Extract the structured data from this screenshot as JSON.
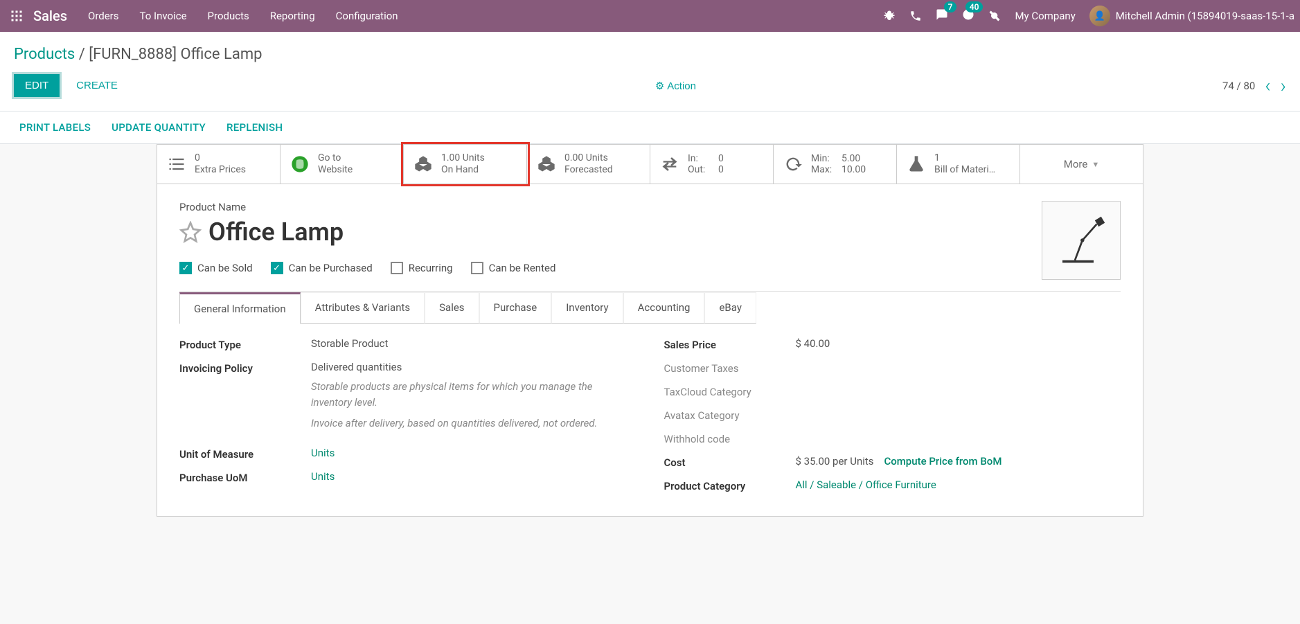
{
  "nav": {
    "brand": "Sales",
    "menu": [
      "Orders",
      "To Invoice",
      "Products",
      "Reporting",
      "Configuration"
    ],
    "messages_badge": "7",
    "activities_badge": "40",
    "company": "My Company",
    "user": "Mitchell Admin (15894019-saas-15-1-a"
  },
  "breadcrumb": {
    "parent": "Products",
    "current": "[FURN_8888] Office Lamp"
  },
  "controls": {
    "edit": "EDIT",
    "create": "CREATE",
    "action": "Action",
    "pager": "74 / 80"
  },
  "status_actions": [
    "PRINT LABELS",
    "UPDATE QUANTITY",
    "REPLENISH"
  ],
  "stats": {
    "extra_prices": {
      "line1": "0",
      "line2": "Extra Prices"
    },
    "website": {
      "line1": "Go to",
      "line2": "Website"
    },
    "on_hand": {
      "line1": "1.00 Units",
      "line2": "On Hand"
    },
    "forecasted": {
      "line1": "0.00 Units",
      "line2": "Forecasted"
    },
    "in_out": {
      "in_label": "In:",
      "in_val": "0",
      "out_label": "Out:",
      "out_val": "0"
    },
    "min_max": {
      "min_label": "Min:",
      "min_val": "5.00",
      "max_label": "Max:",
      "max_val": "10.00"
    },
    "bom": {
      "line1": "1",
      "line2": "Bill of Materi…"
    },
    "more": "More"
  },
  "product": {
    "name_label": "Product Name",
    "name": "Office Lamp",
    "checks": {
      "sold": "Can be Sold",
      "purchased": "Can be Purchased",
      "recurring": "Recurring",
      "rented": "Can be Rented"
    }
  },
  "tabs": [
    "General Information",
    "Attributes & Variants",
    "Sales",
    "Purchase",
    "Inventory",
    "Accounting",
    "eBay"
  ],
  "fields_left": {
    "product_type_label": "Product Type",
    "product_type": "Storable Product",
    "invoicing_policy_label": "Invoicing Policy",
    "invoicing_policy": "Delivered quantities",
    "help1": "Storable products are physical items for which you manage the inventory level.",
    "help2": "Invoice after delivery, based on quantities delivered, not ordered.",
    "uom_label": "Unit of Measure",
    "uom": "Units",
    "purchase_uom_label": "Purchase UoM",
    "purchase_uom": "Units"
  },
  "fields_right": {
    "sales_price_label": "Sales Price",
    "sales_price": "$ 40.00",
    "customer_taxes_label": "Customer Taxes",
    "taxcloud_label": "TaxCloud Category",
    "avatax_label": "Avatax Category",
    "withhold_label": "Withhold code",
    "cost_label": "Cost",
    "cost": "$ 35.00 per Units",
    "compute_bom": "Compute Price from BoM",
    "category_label": "Product Category",
    "category": "All / Saleable / Office Furniture"
  }
}
